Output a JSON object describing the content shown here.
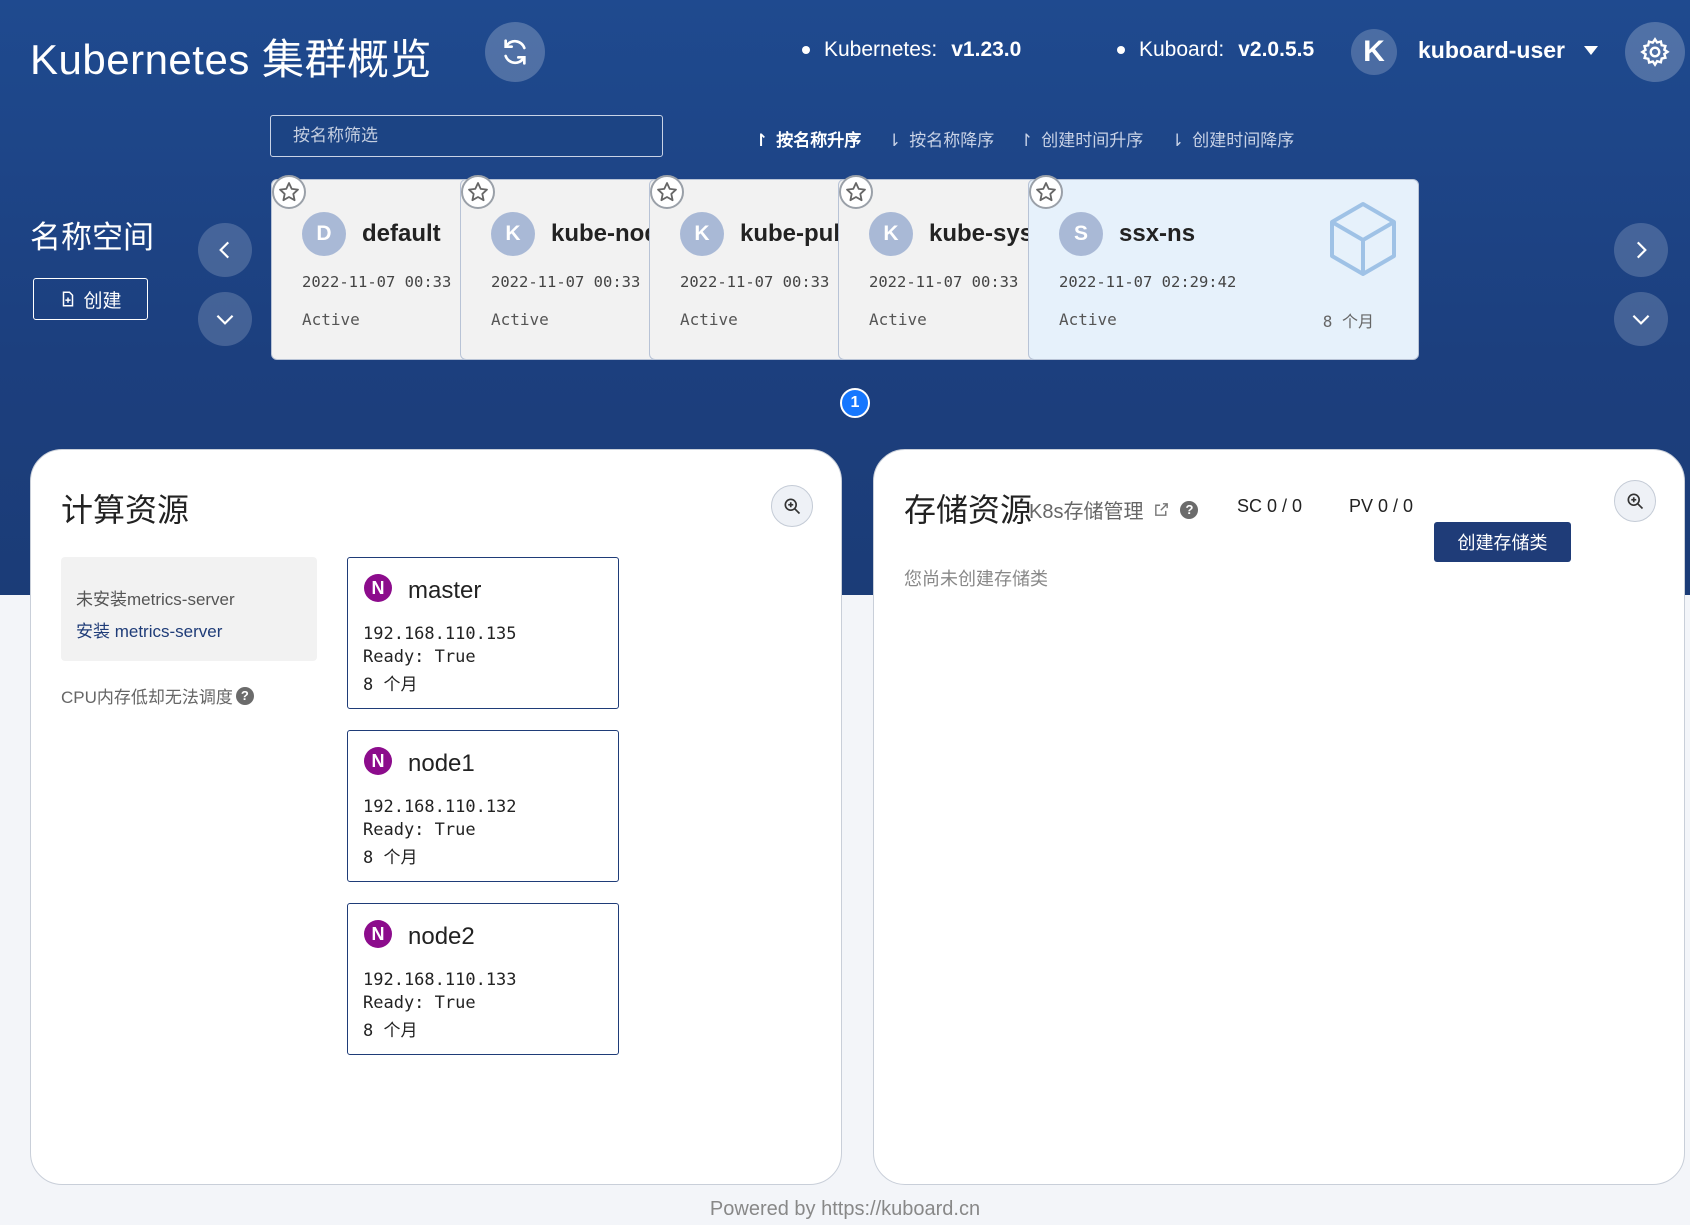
{
  "header": {
    "title": "Kubernetes 集群概览",
    "kubernetes_label": "Kubernetes:",
    "kubernetes_version": "v1.23.0",
    "kuboard_label": "Kuboard:",
    "kuboard_version": "v2.0.5.5",
    "user_initial": "K",
    "user_name": "kuboard-user"
  },
  "filter": {
    "placeholder": "按名称筛选"
  },
  "sort_options": [
    {
      "label": "按名称升序",
      "arrow": "↾",
      "active": true
    },
    {
      "label": "按名称降序",
      "arrow": "⇂",
      "active": false
    },
    {
      "label": "创建时间升序",
      "arrow": "↾",
      "active": false
    },
    {
      "label": "创建时间降序",
      "arrow": "⇂",
      "active": false
    }
  ],
  "namespaces": {
    "label": "名称空间",
    "create_label": "创建",
    "items": [
      {
        "initial": "D",
        "name": "default",
        "created": "2022-11-07 00:33",
        "status": "Active"
      },
      {
        "initial": "K",
        "name": "kube-node-lease",
        "created": "2022-11-07 00:33",
        "status": "Active"
      },
      {
        "initial": "K",
        "name": "kube-public",
        "created": "2022-11-07 00:33",
        "status": "Active"
      },
      {
        "initial": "K",
        "name": "kube-system",
        "created": "2022-11-07 00:33",
        "status": "Active"
      },
      {
        "initial": "S",
        "name": "ssx-ns",
        "created": "2022-11-07 02:29:42",
        "status": "Active",
        "age": "8 个月"
      }
    ],
    "page": "1"
  },
  "compute": {
    "title": "计算资源",
    "metrics_missing": "未安装metrics-server",
    "install_metrics": "安装 metrics-server",
    "cpu_note": "CPU内存低却无法调度",
    "help": "?",
    "nodes": [
      {
        "badge": "N",
        "name": "master",
        "ip": "192.168.110.135",
        "ready": "Ready: True",
        "age": "8 个月"
      },
      {
        "badge": "N",
        "name": "node1",
        "ip": "192.168.110.132",
        "ready": "Ready: True",
        "age": "8 个月"
      },
      {
        "badge": "N",
        "name": "node2",
        "ip": "192.168.110.133",
        "ready": "Ready: True",
        "age": "8 个月"
      }
    ]
  },
  "storage": {
    "title": "存储资源",
    "subtitle": "K8s存储管理",
    "help": "?",
    "sc": "SC 0 / 0",
    "pv": "PV 0 / 0",
    "create_label": "创建存储类",
    "empty_note": "您尚未创建存储类"
  },
  "footer": "Powered by https://kuboard.cn",
  "colors": {
    "hero": "#1f4a8f",
    "accent": "#1f3c78",
    "node_badge": "#8c0c8c",
    "page_dot": "#1677ff"
  }
}
